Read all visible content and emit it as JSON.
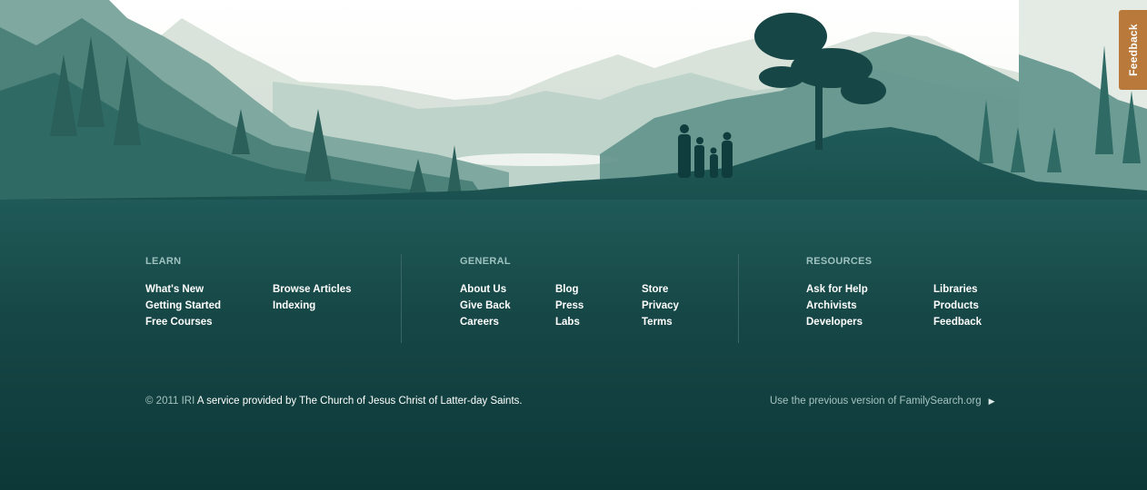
{
  "learn": {
    "title": "LEARN",
    "links": [
      "What's New",
      "Getting Started",
      "Free Courses",
      "Browse Articles",
      "Indexing"
    ]
  },
  "general": {
    "title": "GENERAL",
    "links": [
      "About Us",
      "Give Back",
      "Careers",
      "Blog",
      "Press",
      "Labs",
      "Store",
      "Privacy",
      "Terms"
    ]
  },
  "resources": {
    "title": "RESOURCES",
    "links": [
      "Ask for Help",
      "Archivists",
      "Developers",
      "Libraries",
      "Products",
      "Feedback"
    ]
  },
  "copyright": {
    "year": "© 2011 IRI",
    "service": "A service provided by The Church of Jesus Christ of Latter-day Saints."
  },
  "previous_version": {
    "label": "Use the previous version of FamilySearch.org",
    "arrow_icon": "chevron-right-icon"
  },
  "feedback_tab": {
    "label": "Feedback"
  },
  "colors": {
    "footer_bg": "#0f3c3d",
    "feedback_tab": "#b8793a",
    "heading": "#9ec2bf"
  }
}
